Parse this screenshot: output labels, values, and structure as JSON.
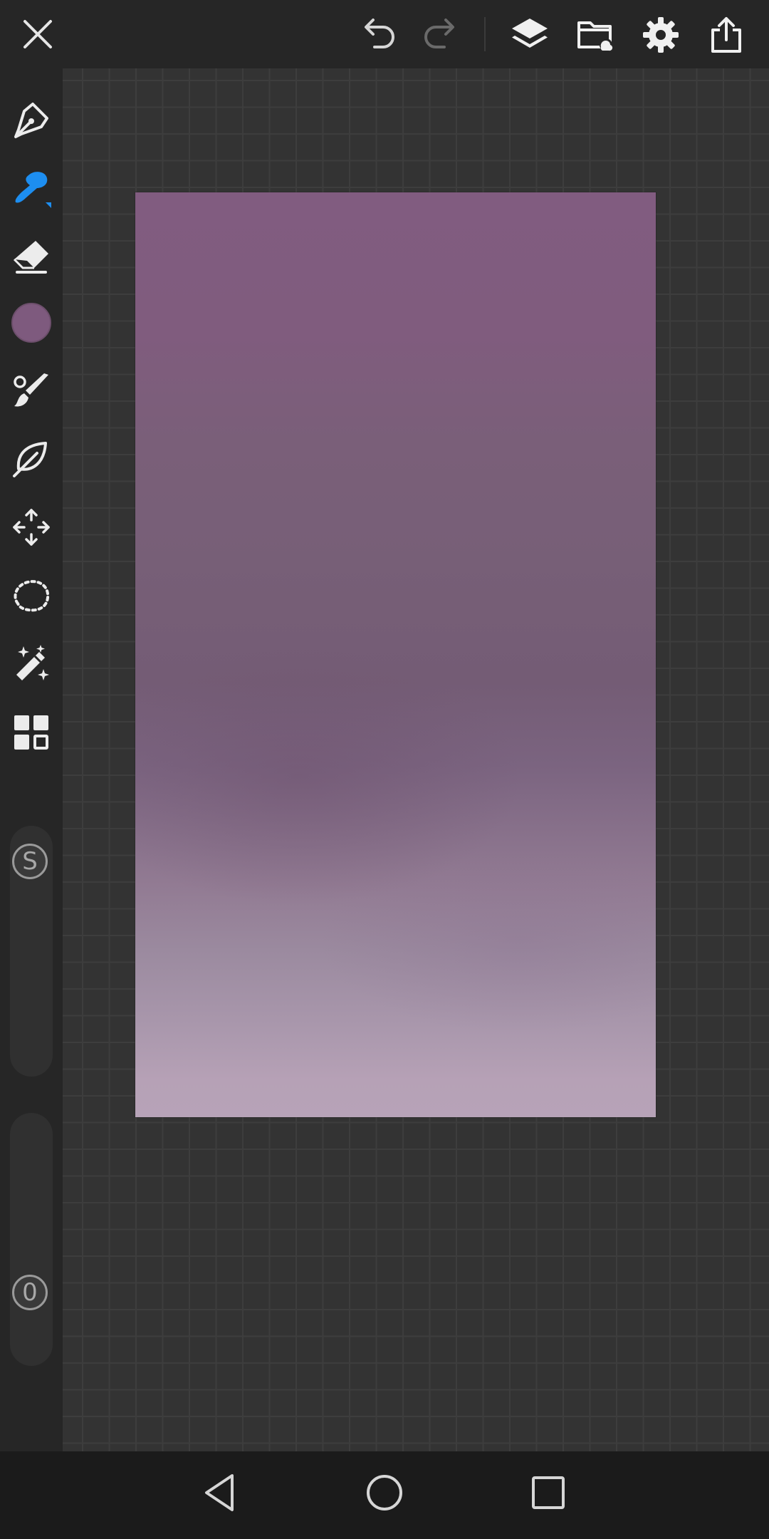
{
  "app": {
    "current_color": "#7e5a7e",
    "accent_color": "#1d8ef0"
  },
  "toolbar": {
    "close": "close-icon",
    "undo": "undo-icon",
    "redo": "redo-icon",
    "layers": "layers-icon",
    "file": "folder-icon",
    "settings": "gear-icon",
    "export": "share-icon"
  },
  "tools": [
    {
      "id": "pen",
      "icon": "pen-tool-icon",
      "active": false
    },
    {
      "id": "brush",
      "icon": "brush-icon",
      "active": true
    },
    {
      "id": "eraser",
      "icon": "eraser-icon",
      "active": false
    },
    {
      "id": "color",
      "icon": "color-swatch",
      "active": false
    },
    {
      "id": "brush-settings",
      "icon": "paint-brush-icon",
      "active": false
    },
    {
      "id": "smudge",
      "icon": "leaf-icon",
      "active": false
    },
    {
      "id": "transform",
      "icon": "move-icon",
      "active": false
    },
    {
      "id": "lasso",
      "icon": "lasso-icon",
      "active": false
    },
    {
      "id": "magic-wand",
      "icon": "magic-wand-icon",
      "active": false
    },
    {
      "id": "more",
      "icon": "grid-icon",
      "active": false
    }
  ],
  "sliders": {
    "size": {
      "label": "S",
      "level": 1.0
    },
    "opacity": {
      "label": "0",
      "level": 0.0
    }
  },
  "navbar": {
    "back": "back-icon",
    "home": "home-icon",
    "recents": "recents-icon"
  }
}
